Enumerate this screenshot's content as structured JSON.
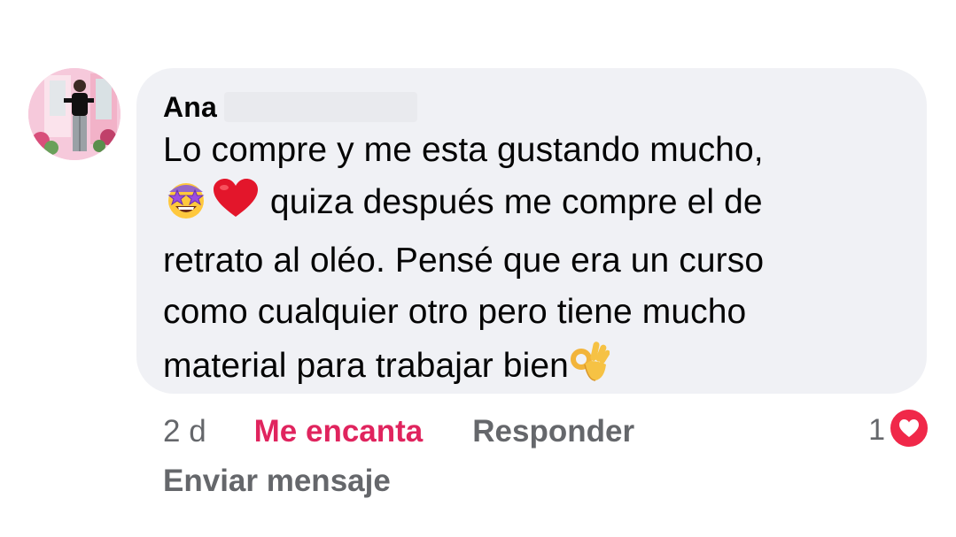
{
  "comment": {
    "author": "Ana",
    "lines": [
      "Lo compre y me esta gustando mucho,",
      " quiza después me compre el de",
      "retrato al oléo. Pensé que era un curso",
      "como cualquier otro pero tiene mucho",
      "material para trabajar bien"
    ],
    "emojis": {
      "line2_start": [
        "star-struck-emoji",
        "red-heart-emoji"
      ],
      "line5_end": "ok-hand-emoji"
    }
  },
  "actions": {
    "time": "2 d",
    "love_label": "Me encanta",
    "reply_label": "Responder",
    "send_message_label": "Enviar mensaje"
  },
  "reactions": {
    "count": "1",
    "icon": "love-reaction-icon"
  },
  "colors": {
    "bubble": "#f0f1f5",
    "love": "#e0245e",
    "secondary_text": "#65676b",
    "reaction_red": "#f02849"
  }
}
